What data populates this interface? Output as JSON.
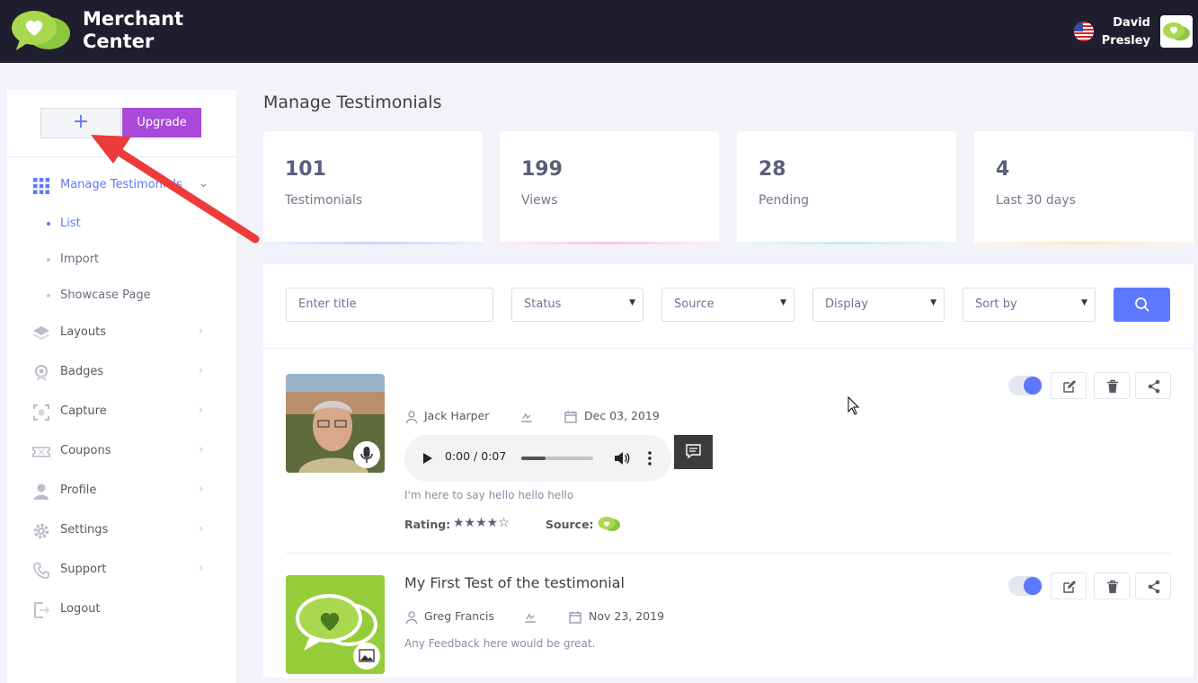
{
  "app": {
    "brand_line1": "Merchant",
    "brand_line2": "Center"
  },
  "user": {
    "first": "David",
    "last": "Presley"
  },
  "sidebar": {
    "plus_label": "+",
    "upgrade_label": "Upgrade",
    "items": [
      {
        "label": "Manage Testimonials",
        "icon": "grid-icon"
      },
      {
        "label": "Layouts",
        "icon": "layers-icon"
      },
      {
        "label": "Badges",
        "icon": "badge-icon"
      },
      {
        "label": "Capture",
        "icon": "capture-icon"
      },
      {
        "label": "Coupons",
        "icon": "coupon-icon"
      },
      {
        "label": "Profile",
        "icon": "user-icon"
      },
      {
        "label": "Settings",
        "icon": "gear-icon"
      },
      {
        "label": "Support",
        "icon": "phone-icon"
      },
      {
        "label": "Logout",
        "icon": "logout-icon"
      }
    ],
    "sub_items": [
      {
        "label": "List"
      },
      {
        "label": "Import"
      },
      {
        "label": "Showcase Page"
      }
    ]
  },
  "page": {
    "title": "Manage Testimonials"
  },
  "stats": [
    {
      "value": "101",
      "label": "Testimonials",
      "color": "#c9d2ff"
    },
    {
      "value": "199",
      "label": "Views",
      "color": "#ffc7d8"
    },
    {
      "value": "28",
      "label": "Pending",
      "color": "#c2ede6"
    },
    {
      "value": "4",
      "label": "Last 30 days",
      "color": "#ffe6bf"
    }
  ],
  "filters": {
    "title_placeholder": "Enter title",
    "status": "Status",
    "source": "Source",
    "display": "Display",
    "sort": "Sort by"
  },
  "testimonials": [
    {
      "author": "Jack Harper",
      "date": "Dec 03, 2019",
      "audio_time": "0:00 / 0:07",
      "text": "I'm here to say hello hello hello",
      "rating_label": "Rating:",
      "rating": 4,
      "stars_display": "★★★★☆",
      "source_label": "Source:"
    },
    {
      "title": "My First Test of the testimonial",
      "author": "Greg Francis",
      "date": "Nov 23, 2019",
      "text": "Any Feedback here would be great."
    }
  ],
  "colors": {
    "accent": "#5d78ff",
    "upgrade": "#a849d8",
    "topbar": "#1f1e2e",
    "brand_green": "#8cc63f"
  }
}
